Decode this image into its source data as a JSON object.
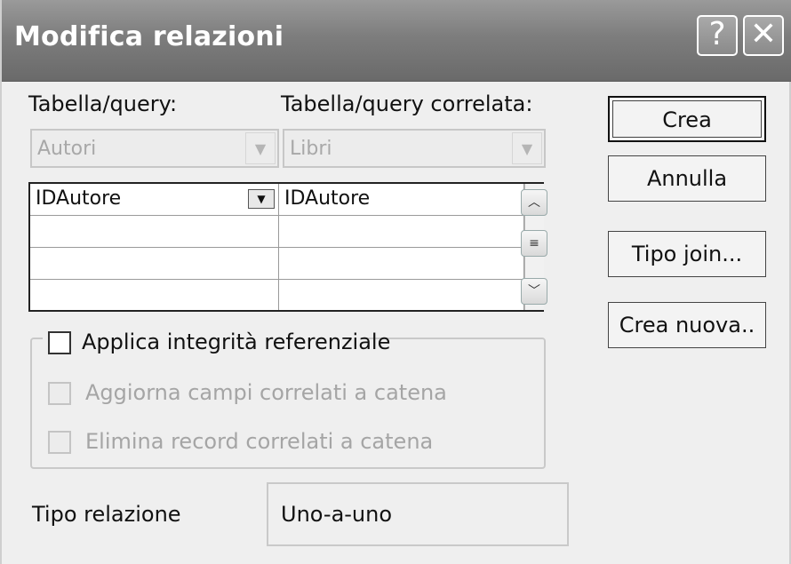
{
  "window": {
    "title": "Modifica relazioni",
    "help_glyph": "?",
    "close_glyph": "✕"
  },
  "tables": {
    "left_label": "Tabella/query:",
    "right_label": "Tabella/query correlata:",
    "left_value": "Autori",
    "right_value": "Libri"
  },
  "fields_grid": {
    "rows": [
      [
        "IDAutore",
        "IDAutore"
      ],
      [
        "",
        ""
      ],
      [
        "",
        ""
      ],
      [
        "",
        ""
      ]
    ],
    "dropdown_glyph": "▼"
  },
  "scrollbar": {
    "up_glyph": "︿",
    "down_glyph": "﹀",
    "thumb_glyph": "≡"
  },
  "buttons": {
    "create": "Crea",
    "cancel": "Annulla",
    "join_type": "Tipo join...",
    "create_new": "Crea nuova.."
  },
  "integrity": {
    "enforce_label": "Applica integrità referenziale",
    "cascade_update_label": "Aggiorna campi correlati a catena",
    "cascade_delete_label": "Elimina record correlati a catena",
    "enforce_checked": false,
    "cascade_update_checked": false,
    "cascade_delete_checked": false
  },
  "relationship_type": {
    "label": "Tipo relazione",
    "value": "Uno-a-uno"
  },
  "colors": {
    "titlebar": "#7d7d7d",
    "dialog_bg": "#efefef"
  }
}
